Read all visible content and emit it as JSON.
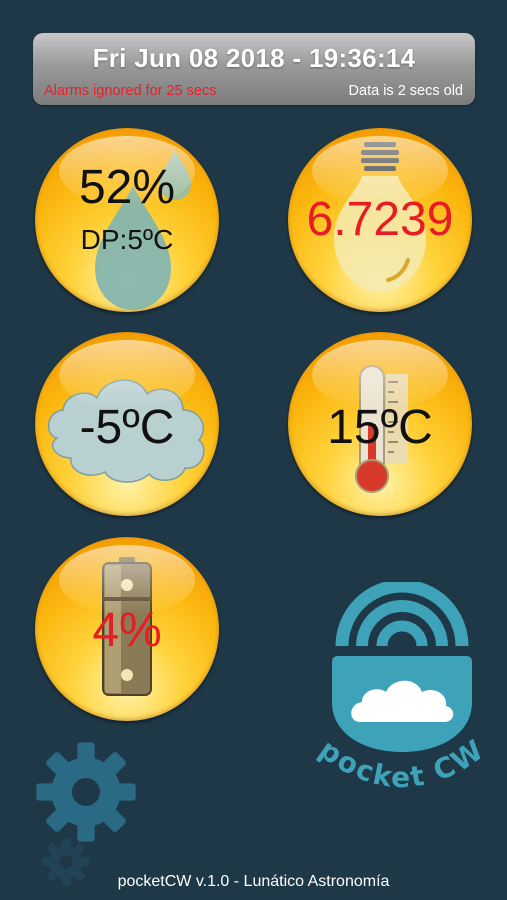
{
  "header": {
    "datetime": "Fri Jun 08 2018 - 19:36:14",
    "alarm_status": "Alarms ignored for 25 secs",
    "data_age": "Data is 2 secs old"
  },
  "sensors": {
    "humidity": {
      "value": "52%",
      "dew_point": "DP:5ºC",
      "icon": "water-drop-icon"
    },
    "light": {
      "value": "6.7239",
      "value_color": "#e81c23",
      "icon": "light-bulb-icon"
    },
    "sky_temp": {
      "value": "-5ºC",
      "icon": "cloud-icon"
    },
    "ambient_temp": {
      "value": "15ºC",
      "icon": "thermometer-icon"
    },
    "battery": {
      "value": "4%",
      "value_color": "#e81c23",
      "icon": "battery-icon"
    }
  },
  "logo": {
    "text": "pocket CW",
    "color": "#3ea2b8"
  },
  "footer": {
    "text": "pocketCW v.1.0 - Lunático Astronomía"
  },
  "colors": {
    "background": "#1e3847",
    "orb": "#fbb60e",
    "alarm": "#e8202a"
  }
}
